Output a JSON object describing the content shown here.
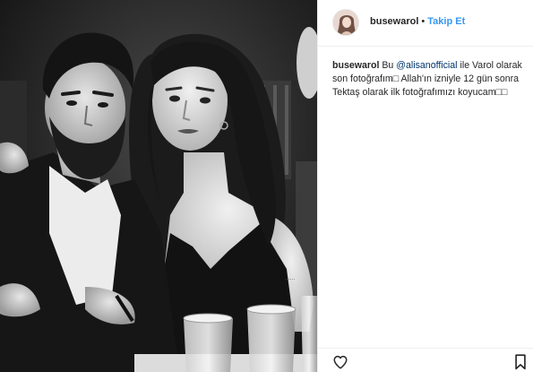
{
  "header": {
    "username": "busewarol",
    "separator": "•",
    "follow_label": "Takip Et"
  },
  "caption": {
    "username": "busewarol",
    "part1": "Bu ",
    "mention": "@alisanofficial",
    "part2": " ile Varol olarak son fotoğrafım",
    "part3": "□ Allah'ın izniyle 12 gün sonra Tektaş olarak ilk fotoğrafımızı koyucam□□"
  },
  "photo": {
    "tattoo_text": "......"
  },
  "icons": {
    "like": "heart-icon",
    "save": "bookmark-icon"
  },
  "colors": {
    "follow": "#3897f0",
    "mention": "#003569",
    "text": "#262626"
  }
}
